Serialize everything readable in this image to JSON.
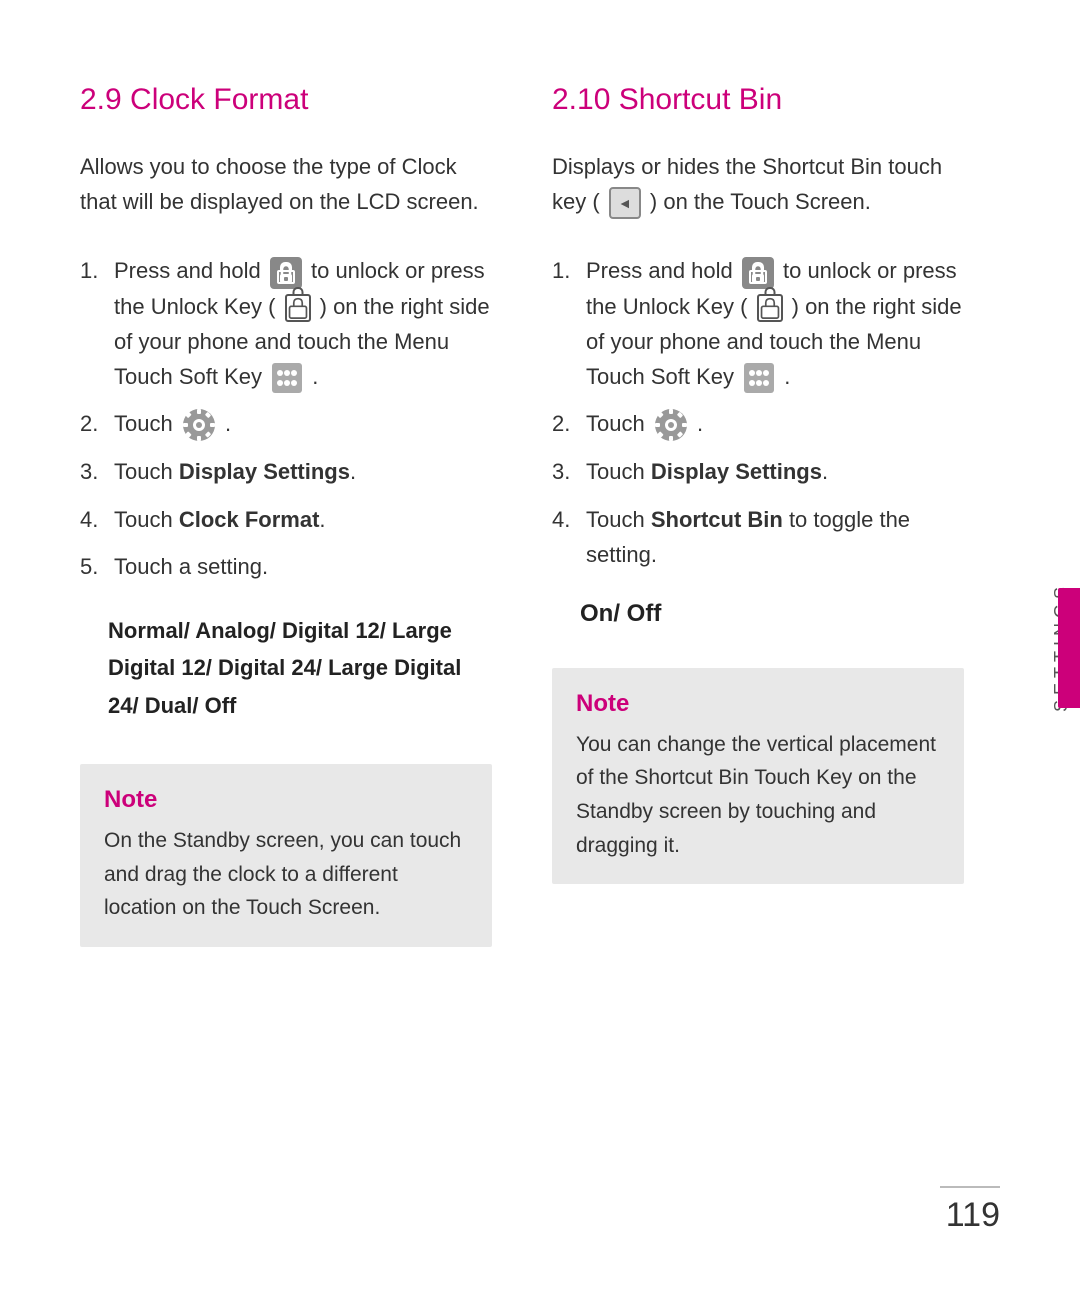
{
  "left_column": {
    "title": "2.9 Clock Format",
    "description": "Allows you to choose the type of Clock that will be displayed on the LCD screen.",
    "steps": [
      {
        "number": "1.",
        "text_before": "Press and hold",
        "icon": "lock",
        "text_middle": "to unlock or press the Unlock Key (",
        "icon2": "lock-small",
        "text_after": ") on the right side of your phone and touch the Menu Touch Soft Key",
        "icon3": "menu",
        "text_end": "."
      },
      {
        "number": "2.",
        "text_before": "Touch",
        "icon": "gear",
        "text_after": "."
      },
      {
        "number": "3.",
        "text_plain": "Touch ",
        "text_bold": "Display Settings",
        "text_end": "."
      },
      {
        "number": "4.",
        "text_plain": "Touch ",
        "text_bold": "Clock Format",
        "text_end": "."
      },
      {
        "number": "5.",
        "text_plain": "Touch a setting."
      }
    ],
    "settings_options": "Normal/ Analog/ Digital 12/ Large Digital 12/ Digital 24/ Large Digital 24/ Dual/ Off",
    "note_title": "Note",
    "note_text": "On the Standby screen, you can touch and drag the clock to a different location on the Touch Screen."
  },
  "right_column": {
    "title": "2.10 Shortcut Bin",
    "description_parts": [
      "Displays or hides the Shortcut Bin touch key (",
      ") on the Touch Screen."
    ],
    "steps": [
      {
        "number": "1.",
        "text_before": "Press and hold",
        "icon": "lock",
        "text_middle": "to unlock or press the Unlock Key (",
        "icon2": "lock-small",
        "text_after": ") on the right side of your phone and touch the Menu Touch Soft Key",
        "icon3": "menu",
        "text_end": "."
      },
      {
        "number": "2.",
        "text_before": "Touch",
        "icon": "gear",
        "text_after": "."
      },
      {
        "number": "3.",
        "text_plain": "Touch ",
        "text_bold": "Display Settings",
        "text_end": "."
      },
      {
        "number": "4.",
        "text_plain": "Touch ",
        "text_bold": "Shortcut Bin",
        "text_middle": " to toggle the setting."
      }
    ],
    "on_off": "On/ Off",
    "note_title": "Note",
    "note_text": "You can change the vertical placement of the Shortcut Bin Touch Key on the Standby screen by touching and dragging it."
  },
  "sidebar": {
    "label": "SETTINGS"
  },
  "footer": {
    "page_number": "119"
  }
}
